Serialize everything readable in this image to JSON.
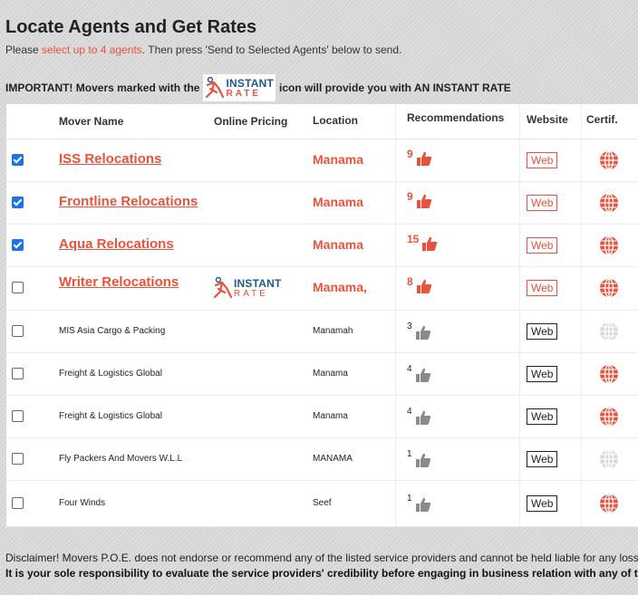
{
  "title": "Locate Agents and Get Rates",
  "instructions": {
    "prefix": "Please ",
    "highlight": "select up to 4 agents",
    "suffix": ". Then press 'Send to Selected Agents' below to send."
  },
  "important": {
    "prefix": "IMPORTANT! Movers marked with the",
    "suffix": "icon will provide you with AN INSTANT RATE"
  },
  "logo": {
    "line1": "INSTANT",
    "line2": "RATE"
  },
  "columns": {
    "mover_name": "Mover Name",
    "online_pricing": "Online Pricing",
    "location": "Location",
    "recommendations": "Recommendations",
    "website": "Website",
    "certif": "Certif."
  },
  "rows": [
    {
      "name": "ISS Relocations",
      "location": "Manama",
      "recommendations": "9",
      "website": "Web",
      "checked": true,
      "featured": true,
      "instant_rate": false,
      "certified": true
    },
    {
      "name": "Frontline Relocations",
      "location": "Manama",
      "recommendations": "9",
      "website": "Web",
      "checked": true,
      "featured": true,
      "instant_rate": false,
      "certified": true
    },
    {
      "name": "Aqua Relocations",
      "location": "Manama",
      "recommendations": "15",
      "website": "Web",
      "checked": true,
      "featured": true,
      "instant_rate": false,
      "certified": true
    },
    {
      "name": "Writer Relocations",
      "location": "Manama,",
      "recommendations": "8",
      "website": "Web",
      "checked": false,
      "featured": true,
      "instant_rate": true,
      "certified": true
    },
    {
      "name": "MIS Asia Cargo & Packing",
      "location": "Manamah",
      "recommendations": "3",
      "website": "Web",
      "checked": false,
      "featured": false,
      "instant_rate": false,
      "certified": false
    },
    {
      "name": "Freight & Logistics Global",
      "location": "Manama",
      "recommendations": "4",
      "website": "Web",
      "checked": false,
      "featured": false,
      "instant_rate": false,
      "certified": true
    },
    {
      "name": "Freight & Logistics Global",
      "location": "Manama",
      "recommendations": "4",
      "website": "Web",
      "checked": false,
      "featured": false,
      "instant_rate": false,
      "certified": true
    },
    {
      "name": "Fly Packers And Movers W.L.L",
      "location": "MANAMA",
      "recommendations": "1",
      "website": "Web",
      "checked": false,
      "featured": false,
      "instant_rate": false,
      "certified": false
    },
    {
      "name": "Four Winds",
      "location": "Seef",
      "recommendations": "1",
      "website": "Web",
      "checked": false,
      "featured": false,
      "instant_rate": false,
      "certified": true
    }
  ],
  "disclaimer": {
    "line1": "Disclaimer! Movers P.O.E. does not endorse or recommend any of the listed service providers and cannot be held liable for any loss",
    "line2": "It is your sole responsibility to evaluate the service providers' credibility before engaging in business relation with any of t"
  },
  "colors": {
    "accent": "#e8533c",
    "logo_blue": "#1e5a8c",
    "checkbox": "#1a73e8",
    "thumb_gray": "#8a8a8a",
    "globe_gray": "#d9d9d9"
  },
  "icons": {
    "thumb": "thumbs-up-icon",
    "globe": "globe-icon",
    "logo": "instant-rate-logo-icon",
    "checkbox": "checkbox-icon"
  }
}
